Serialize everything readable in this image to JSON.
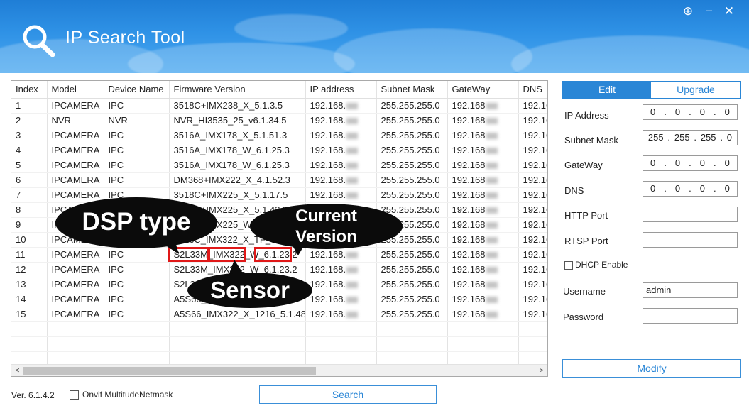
{
  "app": {
    "title": "IP Search Tool",
    "version": "Ver. 6.1.4.2"
  },
  "window_controls": {
    "add": "⊕",
    "minimize": "−",
    "close": "✕"
  },
  "table": {
    "columns": [
      "Index",
      "Model",
      "Device Name",
      "Firmware Version",
      "IP address",
      "Subnet Mask",
      "GateWay",
      "DNS"
    ],
    "rows": [
      {
        "index": "1",
        "model": "IPCAMERA",
        "name": "IPC",
        "firmware": "3518C+IMX238_X_5.1.3.5",
        "ip": "192.168.",
        "mask": "255.255.255.0",
        "gw": "192.168",
        "dns": "192.16"
      },
      {
        "index": "2",
        "model": "NVR",
        "name": "NVR",
        "firmware": "NVR_HI3535_25_v6.1.34.5",
        "ip": "192.168.",
        "mask": "255.255.255.0",
        "gw": "192.168",
        "dns": "192.16"
      },
      {
        "index": "3",
        "model": "IPCAMERA",
        "name": "IPC",
        "firmware": "3516A_IMX178_X_5.1.51.3",
        "ip": "192.168.",
        "mask": "255.255.255.0",
        "gw": "192.168",
        "dns": "192.16"
      },
      {
        "index": "4",
        "model": "IPCAMERA",
        "name": "IPC",
        "firmware": "3516A_IMX178_W_6.1.25.3",
        "ip": "192.168.",
        "mask": "255.255.255.0",
        "gw": "192.168",
        "dns": "192.16"
      },
      {
        "index": "5",
        "model": "IPCAMERA",
        "name": "IPC",
        "firmware": "3516A_IMX178_W_6.1.25.3",
        "ip": "192.168.",
        "mask": "255.255.255.0",
        "gw": "192.168",
        "dns": "192.16"
      },
      {
        "index": "6",
        "model": "IPCAMERA",
        "name": "IPC",
        "firmware": "DM368+IMX222_X_4.1.52.3",
        "ip": "192.168.",
        "mask": "255.255.255.0",
        "gw": "192.168",
        "dns": "192.16"
      },
      {
        "index": "7",
        "model": "IPCAMERA",
        "name": "IPC",
        "firmware": "3518C+IMX225_X_5.1.17.5",
        "ip": "192.168.",
        "mask": "255.255.255.0",
        "gw": "192.168",
        "dns": "192.16"
      },
      {
        "index": "8",
        "model": "IPCAMERA",
        "name": "IPC",
        "firmware": "3518C+IMX225_X_5.1.43.5",
        "ip": "192.168.",
        "mask": "255.255.255.0",
        "gw": "192.168",
        "dns": "192.16"
      },
      {
        "index": "9",
        "model": "IPCAMERA",
        "name": "IPC",
        "firmware": "3518C+IMX225_W_6.1.23.2",
        "ip": "192.168.",
        "mask": "255.255.255.0",
        "gw": "192.168",
        "dns": "192.16"
      },
      {
        "index": "10",
        "model": "IPCAMERA",
        "name": "IPC",
        "firmware": "3516C_IMX322_X_TF_6.0.5.4",
        "ip": "192.168.",
        "mask": "255.255.255.0",
        "gw": "192.168",
        "dns": "192.16"
      },
      {
        "index": "11",
        "model": "IPCAMERA",
        "name": "IPC",
        "firmware": "S2L33M_IMX322_W_6.1.23.2",
        "ip": "192.168.",
        "mask": "255.255.255.0",
        "gw": "192.168",
        "dns": "192.16"
      },
      {
        "index": "12",
        "model": "IPCAMERA",
        "name": "IPC",
        "firmware": "S2L33M_IMX322_W_6.1.23.2",
        "ip": "192.168.",
        "mask": "255.255.255.0",
        "gw": "192.168",
        "dns": "192.16"
      },
      {
        "index": "13",
        "model": "IPCAMERA",
        "name": "IPC",
        "firmware": "S2L33M_IMX322_W_6.1.23.2",
        "ip": "192.168.",
        "mask": "255.255.255.0",
        "gw": "192.168",
        "dns": "192.16"
      },
      {
        "index": "14",
        "model": "IPCAMERA",
        "name": "IPC",
        "firmware": "A5S66_IMX322_X_5.1.48",
        "ip": "192.168.",
        "mask": "255.255.255.0",
        "gw": "192.168",
        "dns": "192.16"
      },
      {
        "index": "15",
        "model": "IPCAMERA",
        "name": "IPC",
        "firmware": "A5S66_IMX322_X_1216_5.1.48...",
        "ip": "192.168.",
        "mask": "255.255.255.0",
        "gw": "192.168",
        "dns": "192.16"
      }
    ]
  },
  "scroll": {
    "left": "<",
    "right": ">"
  },
  "bottom": {
    "onvif_label": "Onvif MultitudeNetmask",
    "search_label": "Search"
  },
  "panel": {
    "tabs": {
      "edit": "Edit",
      "upgrade": "Upgrade"
    },
    "ip_label": "IP Address",
    "ip_value": [
      "0",
      "0",
      "0",
      "0"
    ],
    "mask_label": "Subnet Mask",
    "mask_value": [
      "255",
      "255",
      "255",
      "0"
    ],
    "gw_label": "GateWay",
    "gw_value": [
      "0",
      "0",
      "0",
      "0"
    ],
    "dns_label": "DNS",
    "dns_value": [
      "0",
      "0",
      "0",
      "0"
    ],
    "http_label": "HTTP Port",
    "http_value": "",
    "rtsp_label": "RTSP Port",
    "rtsp_value": "",
    "dhcp_label": "DHCP Enable",
    "username_label": "Username",
    "username_value": "admin",
    "password_label": "Password",
    "password_value": "",
    "modify_label": "Modify"
  },
  "annotations": {
    "dsp": "DSP type",
    "current_line1": "Current",
    "current_line2": "Version",
    "sensor": "Sensor"
  },
  "colors": {
    "accent": "#2a86d6",
    "header_top": "#1f7ed6",
    "header_bottom": "#4aa8f0",
    "highlight_box": "#e01818",
    "callout": "#0b0b0b"
  }
}
